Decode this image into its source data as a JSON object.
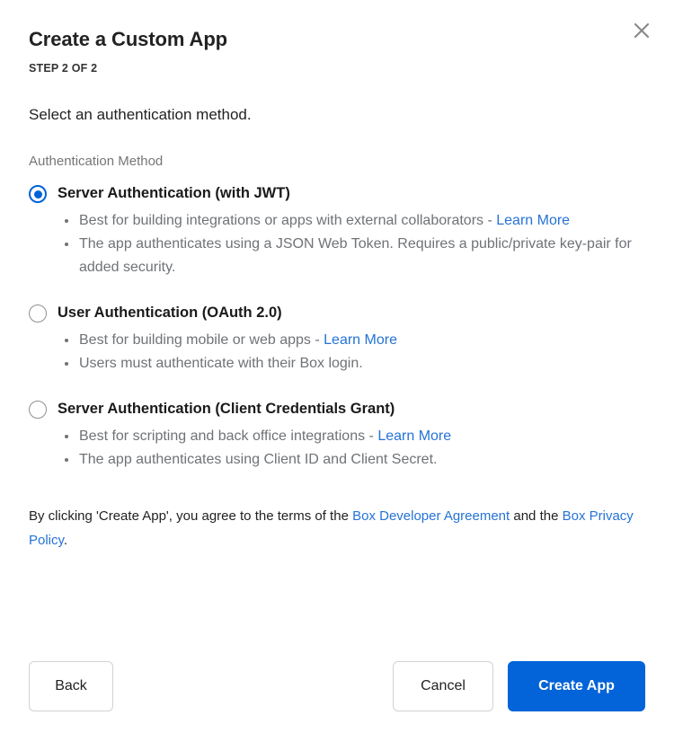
{
  "dialog": {
    "title": "Create a Custom App",
    "step": "STEP 2 OF 2",
    "intro": "Select an authentication method.",
    "close_label": "✕"
  },
  "auth": {
    "group_label": "Authentication Method",
    "options": [
      {
        "title": "Server Authentication (with JWT)",
        "selected": true,
        "bullets": [
          {
            "text_before": "Best for building integrations or apps with external collaborators - ",
            "link": "Learn More",
            "text_after": ""
          },
          {
            "text_before": "The app authenticates using a JSON Web Token. Requires a public/private key-pair for added security.",
            "link": "",
            "text_after": ""
          }
        ]
      },
      {
        "title": "User Authentication (OAuth 2.0)",
        "selected": false,
        "bullets": [
          {
            "text_before": "Best for building mobile or web apps - ",
            "link": "Learn More",
            "text_after": ""
          },
          {
            "text_before": "Users must authenticate with their Box login.",
            "link": "",
            "text_after": ""
          }
        ]
      },
      {
        "title": "Server Authentication (Client Credentials Grant)",
        "selected": false,
        "bullets": [
          {
            "text_before": "Best for scripting and back office integrations - ",
            "link": "Learn More",
            "text_after": ""
          },
          {
            "text_before": "The app authenticates using Client ID and Client Secret.",
            "link": "",
            "text_after": ""
          }
        ]
      }
    ]
  },
  "terms": {
    "part1": "By clicking 'Create App', you agree to the terms of the ",
    "link1": "Box Developer Agreement",
    "part2": " and the ",
    "link2": "Box Privacy Policy",
    "part3": "."
  },
  "footer": {
    "back_label": "Back",
    "cancel_label": "Cancel",
    "create_label": "Create App"
  },
  "colors": {
    "accent": "#0363d8",
    "link": "#2573d6",
    "muted_text": "#6f7277",
    "label_text": "#767676"
  }
}
